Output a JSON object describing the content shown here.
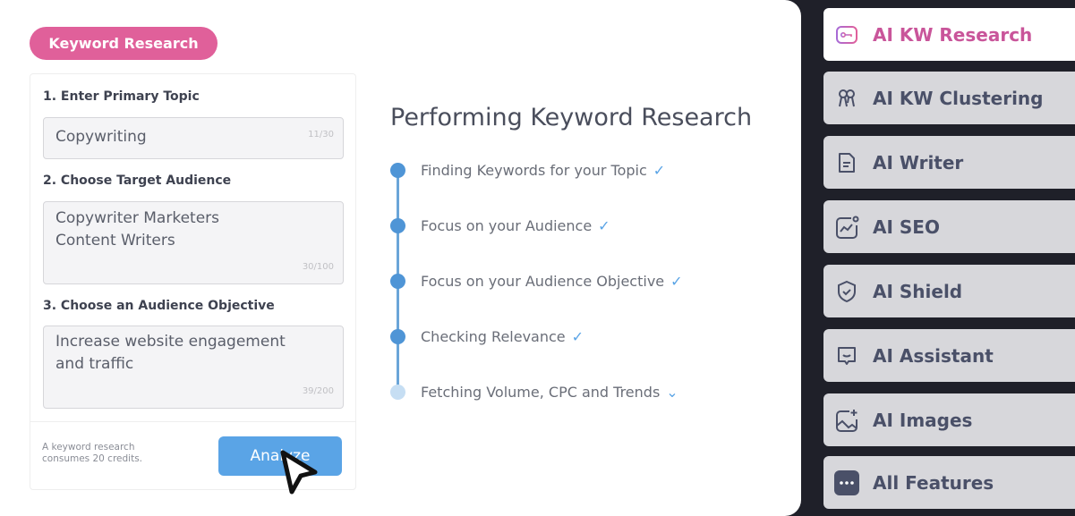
{
  "header": {
    "badge": "Keyword Research"
  },
  "form": {
    "step1_label": "1. Enter Primary Topic",
    "topic_value": "Copywriting",
    "topic_count": "11/30",
    "step2_label": "2. Choose Target Audience",
    "audience_line1": "Copywriter  Marketers",
    "audience_line2": "Content Writers",
    "audience_count": "30/100",
    "step3_label": "3. Choose an Audience Objective",
    "objective_value": "Increase website engagement and traffic",
    "objective_count": "39/200",
    "credits_note": "A keyword research consumes 20 credits.",
    "analyze_label": "Analyze"
  },
  "progress": {
    "title": "Performing Keyword Research",
    "steps": [
      {
        "label": "Finding Keywords for your Topic",
        "status": "done"
      },
      {
        "label": "Focus on your Audience",
        "status": "done"
      },
      {
        "label": "Focus on your Audience Objective",
        "status": "done"
      },
      {
        "label": "Checking Relevance",
        "status": "done"
      },
      {
        "label": "Fetching Volume, CPC and Trends",
        "status": "in-progress"
      }
    ],
    "done_mark": "✓",
    "pending_mark": "⌄"
  },
  "sidebar": {
    "items": [
      {
        "label": "AI KW Research",
        "icon": "key-icon",
        "active": true
      },
      {
        "label": "AI KW Clustering",
        "icon": "cluster-icon"
      },
      {
        "label": "AI Writer",
        "icon": "document-icon"
      },
      {
        "label": "AI SEO",
        "icon": "chart-icon"
      },
      {
        "label": "AI Shield",
        "icon": "shield-icon"
      },
      {
        "label": "AI Assistant",
        "icon": "chat-icon"
      },
      {
        "label": "AI Images",
        "icon": "image-icon"
      },
      {
        "label": "All Features",
        "icon": "more-icon"
      }
    ]
  },
  "colors": {
    "accent": "#e0609a",
    "primary": "#5aa4e6",
    "sidebar_bg": "#1f2029"
  }
}
